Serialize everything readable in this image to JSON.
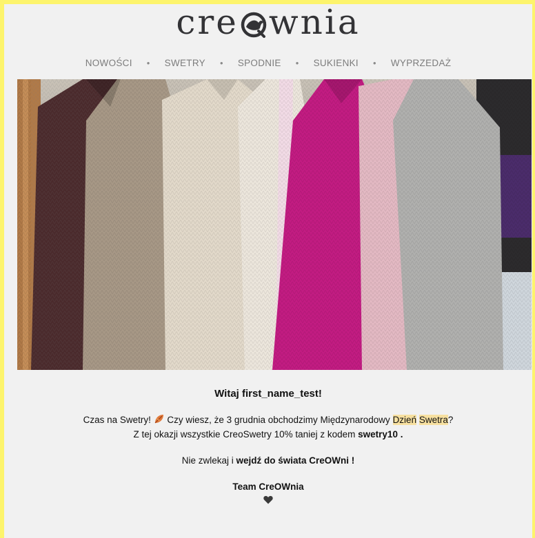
{
  "brand": {
    "logo_left": "cre",
    "logo_right": "wnia",
    "logo_mark": "bird-o-icon"
  },
  "nav": {
    "items": [
      {
        "label": "NOWOŚCI"
      },
      {
        "label": "SWETRY"
      },
      {
        "label": "SPODNIE"
      },
      {
        "label": "SUKIENKI"
      },
      {
        "label": "WYPRZEDAŻ"
      }
    ],
    "separator": "•"
  },
  "hero": {
    "image": "knit-sweaters-on-hangers",
    "sweater_colors": [
      "#4a2a2c",
      "#a79886",
      "#e2d9ca",
      "#ece6dc",
      "#c21c82",
      "#e3b9c3",
      "#b0b0ae"
    ]
  },
  "email": {
    "greeting": "Witaj first_name_test!",
    "line1_a": "Czas na Swetry! ",
    "line1_icon": "autumn-leaf-icon",
    "line1_b": " Czy wiesz, że 3 grudnia obchodzimy Międzynarodowy ",
    "line1_hl1": "Dzień",
    "line1_space": " ",
    "line1_hl2": "Swetra",
    "line1_c": "?",
    "line2_a": "Z tej okazji wszystkie CreoSwetry 10% taniej z kodem ",
    "line2_code": "swetry10 .",
    "line3_a": "Nie zwlekaj i ",
    "line3_b": "wejdź do świata CreOWni !",
    "signature": "Team CreOWnia",
    "signature_icon": "black-heart-icon"
  },
  "colors": {
    "page_border": "#fdf46c",
    "background": "#f1f1f1",
    "nav_text": "#7c7c7c",
    "highlight": "#f7e0a0"
  }
}
